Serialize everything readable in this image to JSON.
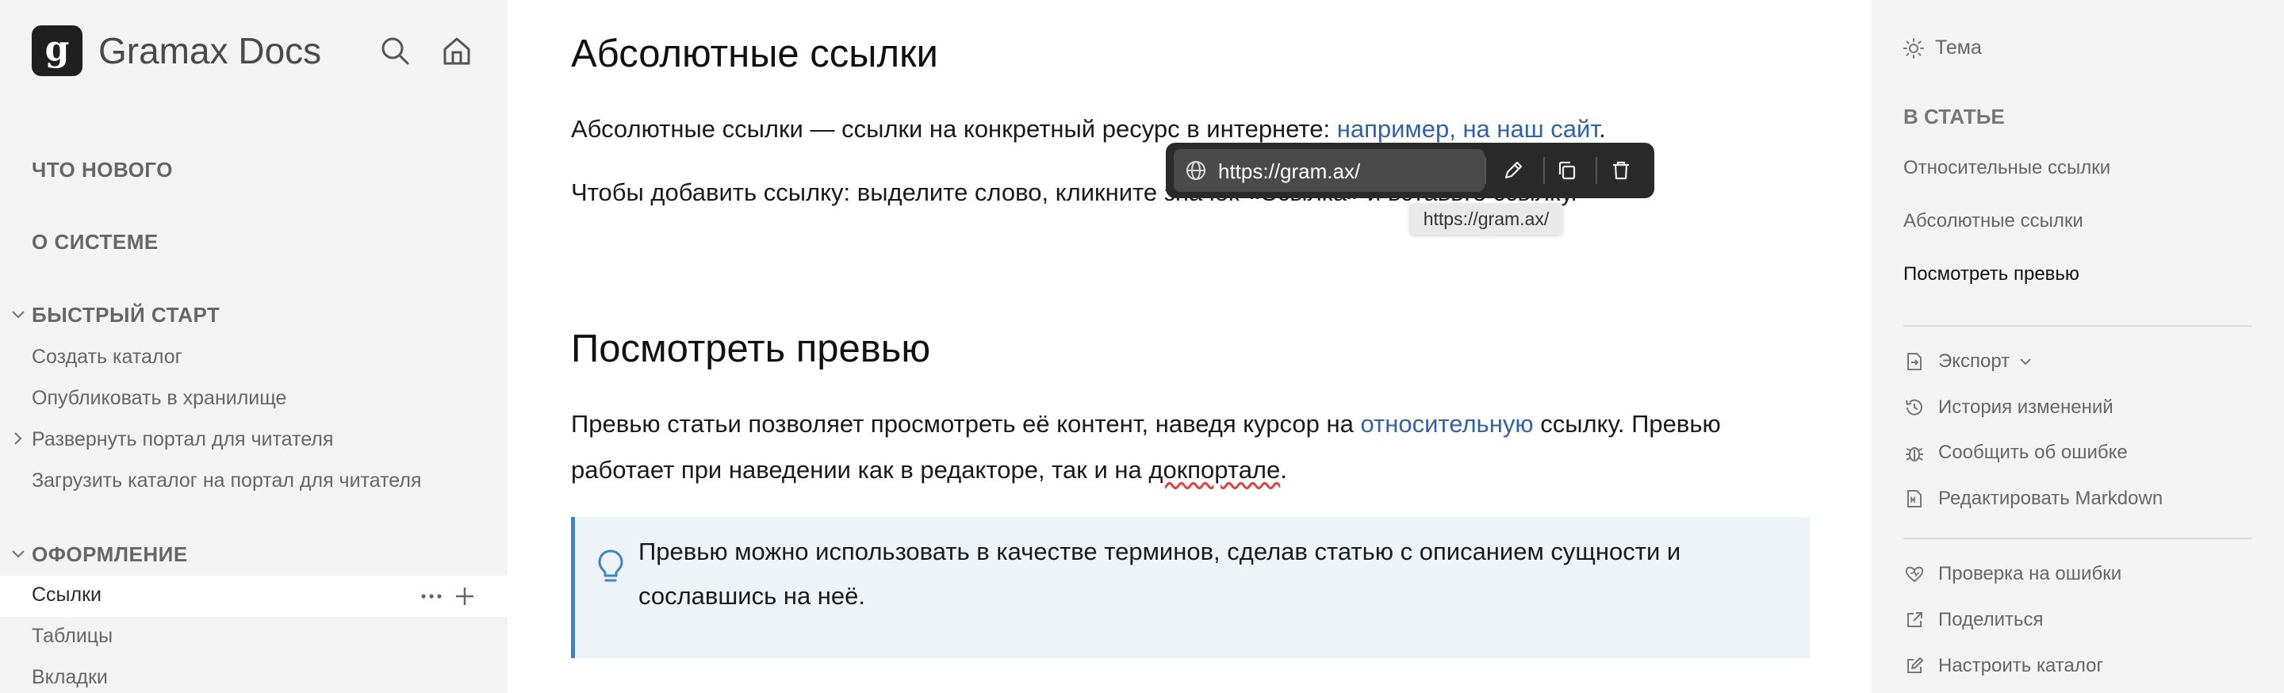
{
  "app": {
    "logo_letter": "g",
    "name": "Gramax Docs"
  },
  "sidebar": {
    "sections": [
      {
        "label": "ЧТО НОВОГО"
      },
      {
        "label": "О СИСТЕМЕ"
      },
      {
        "label": "БЫСТРЫЙ СТАРТ",
        "expanded": true
      },
      {
        "label": "ОФОРМЛЕНИЕ",
        "expanded": true
      }
    ],
    "quickstart_items": [
      {
        "label": "Создать каталог"
      },
      {
        "label": "Опубликовать в хранилище"
      },
      {
        "label": "Развернуть портал для читателя",
        "collapsible": true
      },
      {
        "label": "Загрузить каталог на портал для читателя"
      }
    ],
    "design_items": [
      {
        "label": "Ссылки",
        "active": true
      },
      {
        "label": "Таблицы"
      },
      {
        "label": "Вкладки"
      }
    ]
  },
  "main": {
    "section1": {
      "title": "Абсолютные ссылки",
      "p1_text": "Абсолютные ссылки — ссылки на конкретный ресурс в интернете: ",
      "p1_link": "например, на наш сайт",
      "p1_end": ".",
      "p2_text": "Чтобы добавить ссылку: выделите слово, кликните значок «Ссылка» и вставьте ссылку."
    },
    "link_toolbar": {
      "url": "https://gram.ax/",
      "tooltip": "https://gram.ax/"
    },
    "section2": {
      "title": "Посмотреть превью",
      "p1_a": "Превью статьи позволяет просмотреть её контент, наведя курсор на ",
      "p1_link": "относительную",
      "p1_b": " ссылку. Превью",
      "p2_a": "работает при наведении как в редакторе, так и на ",
      "p2_err": "докпортале",
      "p2_b": ".",
      "callout_line1": "Превью можно использовать в качестве терминов, сделав статью с описанием сущности и",
      "callout_line2": "сославшись на неё."
    }
  },
  "right_sidebar": {
    "theme_label": "Тема",
    "toc_heading": "В СТАТЬЕ",
    "toc": [
      {
        "label": "Относительные ссылки"
      },
      {
        "label": "Абсолютные ссылки"
      },
      {
        "label": "Посмотреть превью",
        "active": true
      }
    ],
    "actions_group1": [
      {
        "label": "Экспорт",
        "icon": "export-icon"
      },
      {
        "label": "История изменений",
        "icon": "history-icon"
      },
      {
        "label": "Сообщить об ошибке",
        "icon": "bug-icon"
      },
      {
        "label": "Редактировать Markdown",
        "icon": "markdown-file-icon"
      }
    ],
    "actions_group2": [
      {
        "label": "Проверка на ошибки",
        "icon": "heart-check-icon"
      },
      {
        "label": "Поделиться",
        "icon": "share-icon"
      },
      {
        "label": "Настроить каталог",
        "icon": "edit-icon"
      }
    ]
  },
  "colors": {
    "link": "#2f62a6",
    "accent": "#3d85c6",
    "sidebar_bg": "#f3f3f3",
    "callout_bg": "#edf3f7"
  }
}
